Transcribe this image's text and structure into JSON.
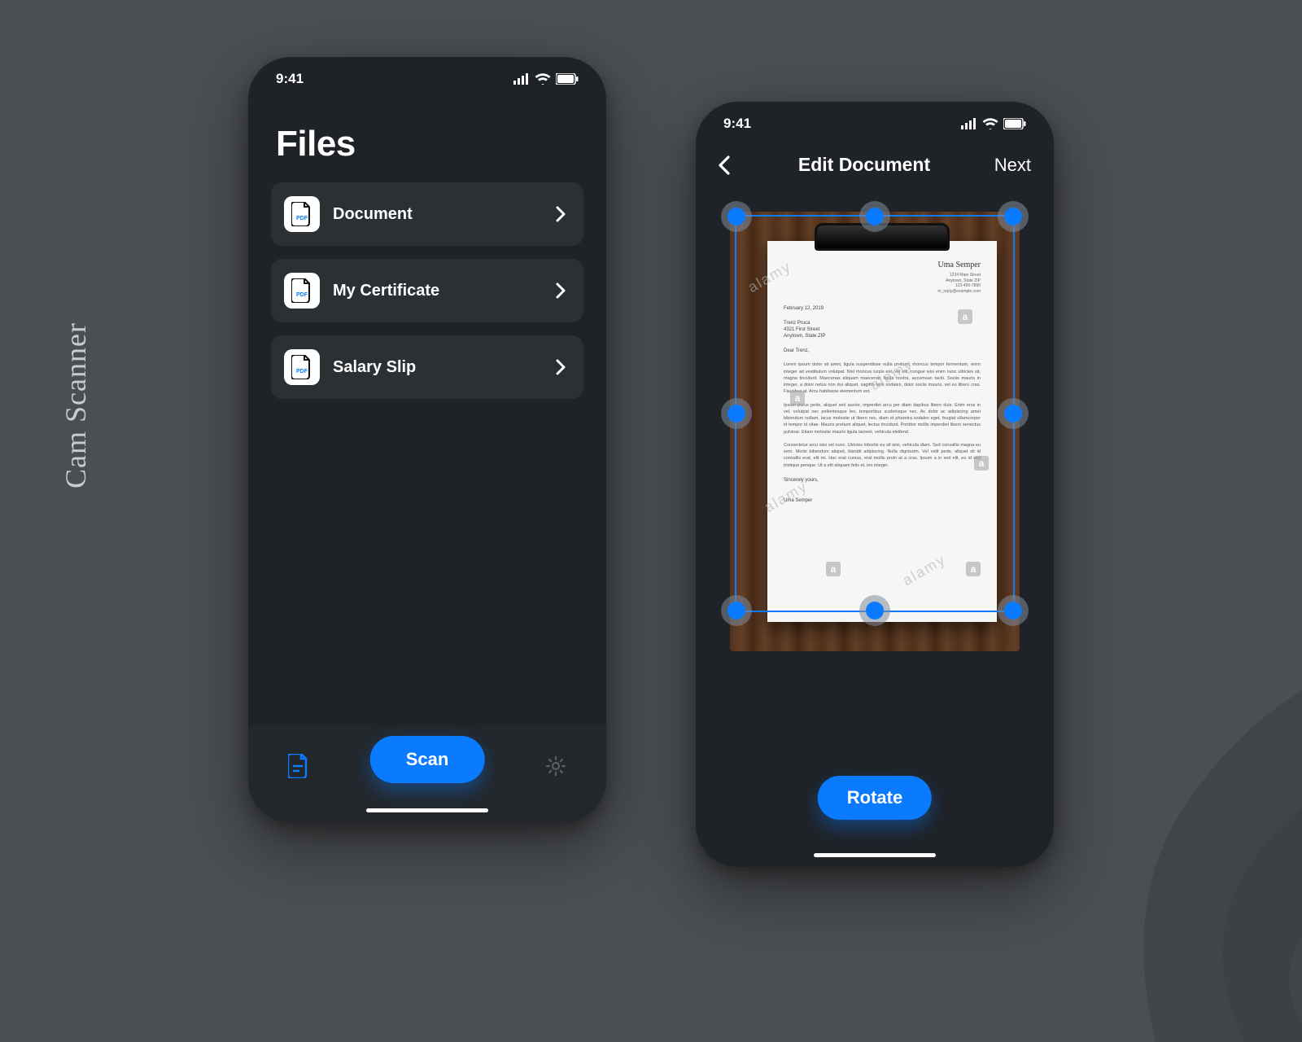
{
  "app_name": "Cam Scanner",
  "status": {
    "time": "9:41"
  },
  "screen1": {
    "title": "Files",
    "files": [
      {
        "label": "Document"
      },
      {
        "label": "My Certificate"
      },
      {
        "label": "Salary Slip"
      }
    ],
    "scan_label": "Scan"
  },
  "screen2": {
    "title": "Edit Document",
    "next_label": "Next",
    "rotate_label": "Rotate",
    "letter": {
      "name": "Uma Semper",
      "addr1": "1234 Main Street",
      "addr2": "Anytown, State ZIP",
      "addr3": "123-456-7890",
      "addr4": "m_reply@example.com",
      "date": "February 12, 2019",
      "to1": "Trenz Pruca",
      "to2": "4321 First Street",
      "to3": "Anytown, State ZIP",
      "greet": "Dear Trenz,",
      "p1": "Lorem ipsum dolor sit amet, ligula suspendisse nulla pretium, rhoncus tempor fermentum, enim integer ad vestibulum volutpat. Nisl rhoncus turpis est, vel elit, congue wisi enim nunc ultricies sit, magna tincidunt. Maecenas aliquam maecenas ligula nostra, accumsan taciti. Sociis mauris in integer, a dolor netus non dui aliquet, sagittis felis sodales, dolor sociis mauris, vel eu libero cras. Faucibus at. Arcu habitasse elementum est.",
      "p2": "Ipsum purus pede, aliquet sed auctor, imperdiet arcu per diam dapibus libero duis. Enim eros in vel, volutpat nec pellentesque leo, temporibus scelerisque nec. Ac dolor ac adipiscing amet bibendum nullam, lacus molestie ut libero nec, diam et pharetra sodales eget, feugiat ullamcorper id tempor id vitae. Mauris pretium aliquet, lectus tincidunt. Porttitor mollis imperdiet libero senectus pulvinar. Etiam molestie mauris ligula laoreet, vehicula eleifend.",
      "p3": "Consectetur arcu wisi vel nunc. Utricies lobortis eu sit wisi, vehicula diam. Sed convallis magna eu sem. Morbi bibendum aliquet, blandit adipiscing. Nulla dignissim. Vel velit pede, aliquet sit id convallis erat, elit mi. Hac erat cursus, erat mollis proin at a cras. Ipsum a in sed elit, eu id sed tristique penque. Ut a elit aliquam felis et, leo integer.",
      "sig1": "Sincerely yours,",
      "sig2": "Uma Semper"
    }
  },
  "colors": {
    "accent": "#0a7aff"
  }
}
